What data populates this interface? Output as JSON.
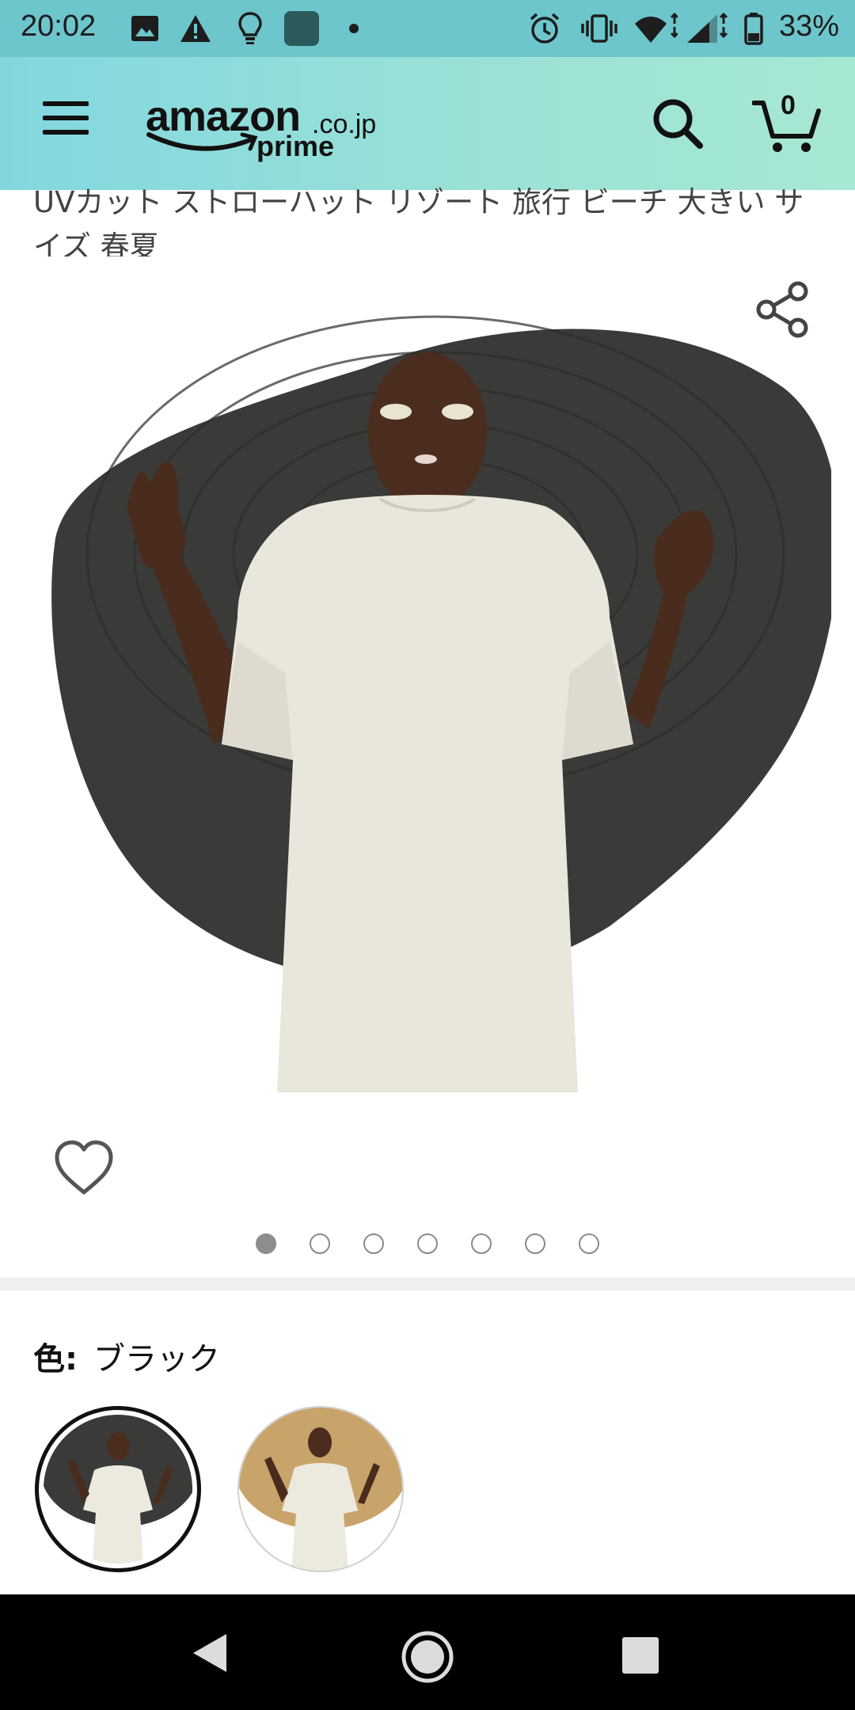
{
  "status_bar": {
    "time": "20:02",
    "battery": "33%",
    "icons": [
      "image-icon",
      "warning-icon",
      "lightbulb-icon",
      "app-icon",
      "dot-icon",
      "alarm-icon",
      "vibrate-icon",
      "wifi-icon",
      "signal-icon",
      "battery-icon"
    ]
  },
  "header": {
    "logo_word": "amazon",
    "logo_tld": ".co.jp",
    "logo_sub": "prime",
    "cart_count": "0",
    "background_start": "#82d7df",
    "background_end": "#a7e8d4"
  },
  "product": {
    "title": "UVカット ストローハット リゾート 旅行 ビーチ 大きい サイズ 春夏",
    "image_count": 7,
    "active_image_index": 0
  },
  "variant": {
    "label": "色:",
    "selected_value": "ブラック",
    "options": [
      {
        "name": "black-hat-swatch",
        "hat_color": "#3a3a38"
      },
      {
        "name": "natural-hat-swatch",
        "hat_color": "#c9a46a"
      }
    ]
  },
  "nav_bar": {
    "icons": [
      "back-icon",
      "home-icon",
      "recents-icon"
    ]
  }
}
